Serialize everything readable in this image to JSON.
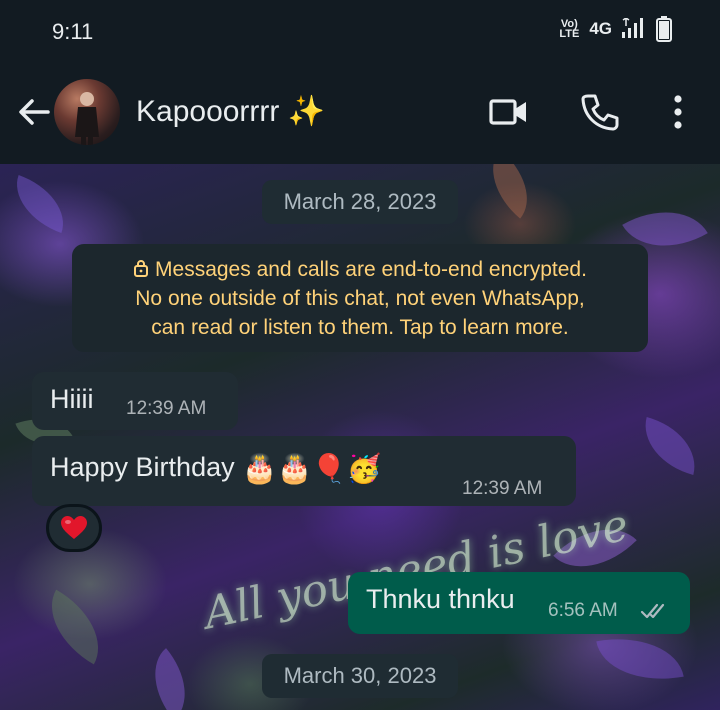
{
  "status_bar": {
    "time": "9:11",
    "volte_label": "Vo) LTE",
    "network": "4G"
  },
  "header": {
    "contact_name": "Kapooorrrr ✨",
    "icons": [
      "back-arrow-icon",
      "video-call-icon",
      "phone-icon",
      "more-options-icon"
    ]
  },
  "chat": {
    "date_chip_1": "March 28, 2023",
    "encryption_notice": {
      "line1": "Messages and calls are end-to-end encrypted.",
      "line2": "No one outside of this chat, not even WhatsApp,",
      "line3": "can read or listen to them. Tap to learn more."
    },
    "messages": [
      {
        "direction": "incoming",
        "text": "Hiiii",
        "time": "12:39 AM"
      },
      {
        "direction": "incoming",
        "text": "Happy Birthday",
        "emojis": "🎂🎂🎈🥳",
        "time": "12:39 AM",
        "reaction": "❤️"
      },
      {
        "direction": "outgoing",
        "text": "Thnku thnku",
        "time": "6:56 AM",
        "status": "read"
      }
    ],
    "date_chip_2": "March 30, 2023"
  },
  "colors": {
    "header_bg": "#121b22",
    "incoming_bubble": "#202c33",
    "outgoing_bubble": "#005c4b",
    "encryption_text": "#ffd279",
    "read_ticks": "#53bdeb"
  }
}
